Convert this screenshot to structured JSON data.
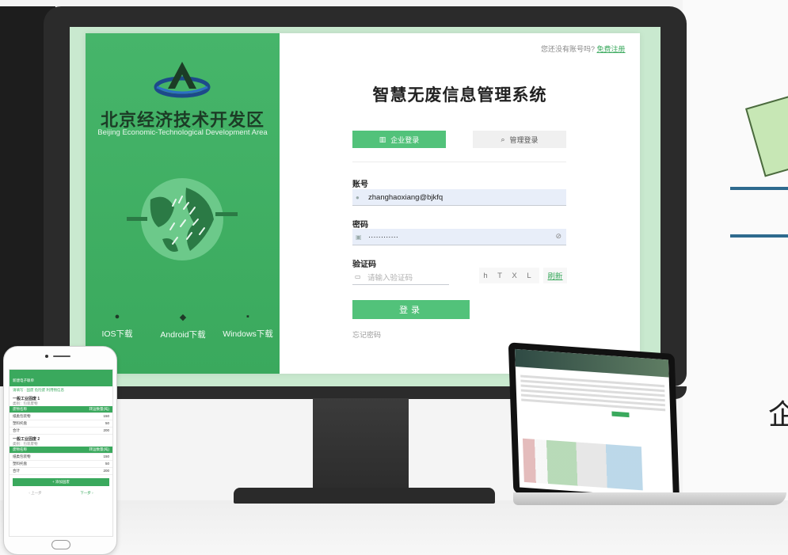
{
  "header": {
    "register_prompt": "您还没有账号吗?",
    "register_link": "免费注册",
    "app_title": "智慧无废信息管理系统"
  },
  "brand": {
    "name_cn": "北京经济技术开发区",
    "name_en": "Beijing Economic-Technological Development Area"
  },
  "downloads": [
    {
      "label": "IOS下载",
      "icon": "apple-icon"
    },
    {
      "label": "Android下载",
      "icon": "android-icon"
    },
    {
      "label": "Windows下载",
      "icon": "windows-icon"
    }
  ],
  "tabs": [
    {
      "label": "企业登录",
      "icon": "building-icon",
      "active": true
    },
    {
      "label": "管理登录",
      "icon": "search-icon",
      "active": false
    }
  ],
  "form": {
    "account_label": "账号",
    "account_value": "zhanghaoxiang@bjkfq",
    "password_label": "密码",
    "password_value": "············",
    "captcha_label": "验证码",
    "captcha_placeholder": "请输入验证码",
    "captcha_text": "h T X L",
    "refresh_label": "刷新",
    "login_label": "登录",
    "forgot_label": "忘记密码"
  },
  "phone": {
    "title": "新建电子联单",
    "section": "请填写 · 固废 危险废 利用物信息",
    "groups": [
      {
        "name": "一般工业固废 1",
        "sub": "类别：包装废物",
        "headers": [
          "废物名称",
          "转运数量(吨)"
        ],
        "rows": [
          [
            "纸类包装物",
            "150"
          ],
          [
            "塑料托盘",
            "50"
          ],
          [
            "合计",
            "200"
          ]
        ]
      },
      {
        "name": "一般工业固废 2",
        "sub": "类别：包装废物",
        "headers": [
          "废物名称",
          "转运数量(吨)"
        ],
        "rows": [
          [
            "纸类包装物",
            "150"
          ],
          [
            "塑料托盘",
            "50"
          ],
          [
            "合计",
            "200"
          ]
        ]
      }
    ],
    "add_button": "+ 添加固废",
    "prev": "‹ 上一步",
    "next": "下一步 ›"
  },
  "decor": {
    "right_char": "企"
  },
  "colors": {
    "brand_green": "#3aa95d",
    "button_green": "#52c27a",
    "field_bg": "#e8eef9"
  }
}
